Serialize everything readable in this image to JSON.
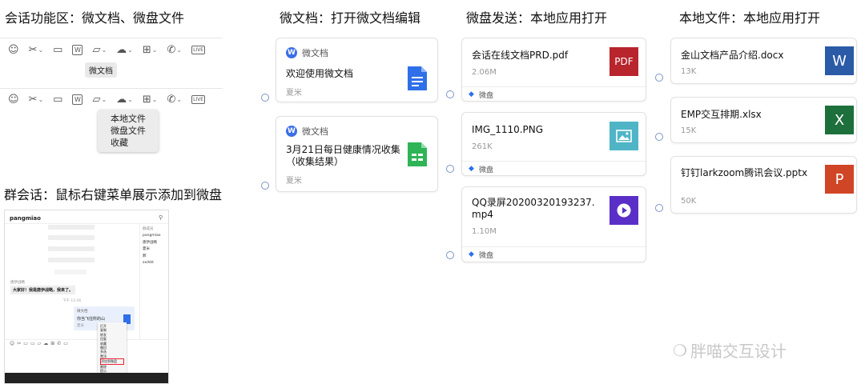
{
  "headings": {
    "chat_area": "会话功能区：微文档、微盘文件",
    "weidoc": "微文档：打开微文档编辑",
    "weipan": "微盘发送：本地应用打开",
    "local": "本地文件：本地应用打开",
    "group": "群会话：鼠标右键菜单展示添加到微盘"
  },
  "toolbar": {
    "icons": [
      "smile-icon",
      "scissors-icon",
      "image-icon",
      "weidoc-icon",
      "folder-icon",
      "cloud-icon",
      "apps-icon",
      "phone-icon",
      "live-icon"
    ],
    "tooltip": "微文档",
    "folder_menu": [
      "本地文件",
      "微盘文件",
      "收藏"
    ]
  },
  "weidoc_cards": [
    {
      "source": "微文档",
      "title": "欢迎使用微文档",
      "owner": "夏米",
      "icon": "doc-icon",
      "color": "#2f6fe8"
    },
    {
      "source": "微文档",
      "title": "3月21日每日健康情况收集（收集结果）",
      "owner": "夏米",
      "icon": "sheet-icon",
      "color": "#2fb457"
    }
  ],
  "weipan_cards": [
    {
      "name": "会话在线文档PRD.pdf",
      "size": "2.06M",
      "source": "微盘",
      "icon": "pdf-icon",
      "icon_text": "PDF",
      "color": "#b8252d"
    },
    {
      "name": "IMG_1110.PNG",
      "size": "261K",
      "source": "微盘",
      "icon": "image-file-icon",
      "icon_text": "",
      "color": "#4fb5c6"
    },
    {
      "name": "QQ录屏20200320193237.mp4",
      "size": "1.10M",
      "source": "微盘",
      "icon": "video-icon",
      "icon_text": "",
      "color": "#5a2fc8"
    }
  ],
  "local_cards": [
    {
      "name": "金山文档产品介绍.docx",
      "size": "13K",
      "icon": "word-icon",
      "icon_text": "W",
      "color": "#2b5aa7"
    },
    {
      "name": "EMP交互排期.xlsx",
      "size": "15K",
      "icon": "excel-icon",
      "icon_text": "X",
      "color": "#1d6f3c"
    },
    {
      "name": "钉钉larkzoom腾讯会议.pptx",
      "size": "50K",
      "icon": "ppt-icon",
      "icon_text": "P",
      "color": "#d04526"
    }
  ],
  "group_chat": {
    "title": "pangmiao",
    "members_label": "群成员",
    "members": [
      "pangmiao",
      "唐伊战略",
      "夏米",
      "郝",
      "zxddd"
    ],
    "time_label": "下午 15:46",
    "sender": "唐伊战略",
    "message": "大家好！我是唐伊战略，我来了。",
    "doc_card_source": "微文档",
    "doc_card_title": "你当飞往所的山",
    "doc_card_owner": "夏米",
    "context_menu": [
      "打开",
      "复制",
      "转发",
      "回复",
      "收藏",
      "撤回",
      "多选",
      "置顶",
      "添加到微盘",
      "删除",
      "提示"
    ],
    "highlighted_item": "添加到微盘"
  },
  "watermark": "胖喵交互设计"
}
